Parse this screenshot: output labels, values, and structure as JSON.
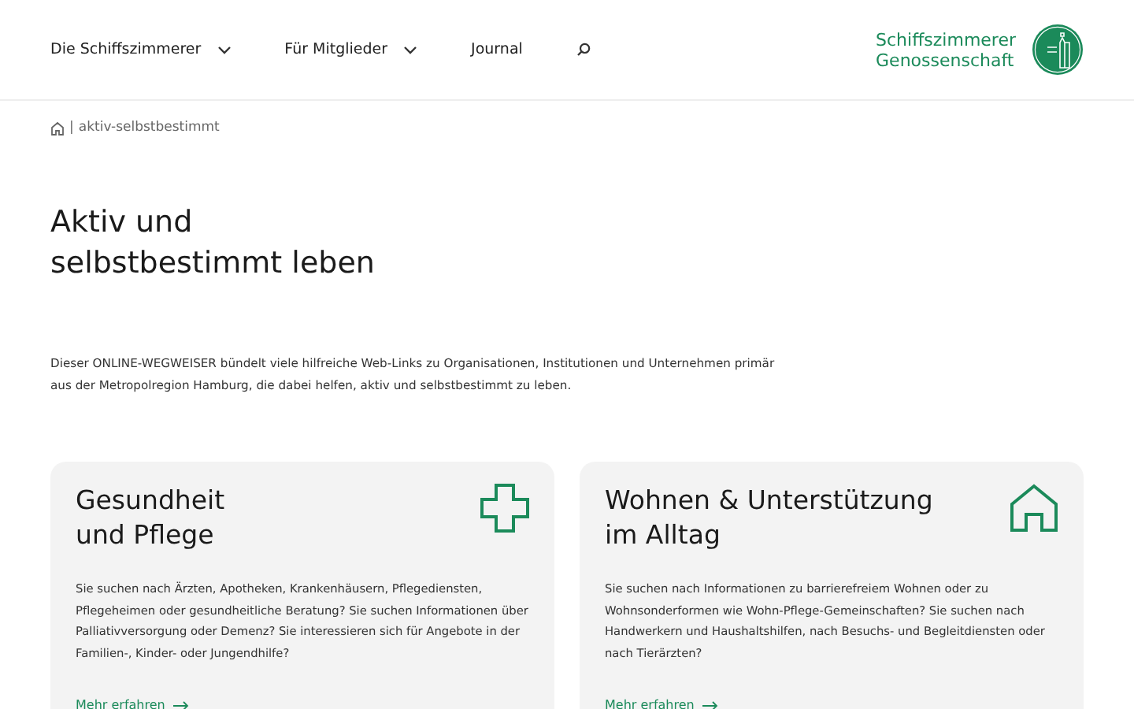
{
  "nav": {
    "items": [
      {
        "label": "Die Schiffszimmerer",
        "dropdown": true
      },
      {
        "label": "Für Mitglieder",
        "dropdown": true
      },
      {
        "label": "Journal",
        "dropdown": false
      }
    ],
    "logo": {
      "line1": "Schiffszimmerer",
      "line2": "Genossenschaft"
    }
  },
  "breadcrumb": {
    "separator": "|",
    "current": "aktiv-selbstbestimmt"
  },
  "title": {
    "line1": "Aktiv und",
    "line2": "selbstbestimmt leben"
  },
  "intro": "Dieser ONLINE-WEGWEISER bündelt viele hilfreiche Web-Links zu Organisationen, Institutionen und Unternehmen primär aus der Metropolregion Hamburg, die dabei helfen, aktiv und selbstbestimmt zu leben.",
  "cards": [
    {
      "kind": "cross",
      "title1": "Gesundheit",
      "title2": "und Pflege",
      "text": "Sie suchen nach Ärzten, Apotheken, Krankenhäusern, Pflegediensten, Pflegeheimen oder gesundheitliche Beratung? Sie suchen Informationen über Palliativversorgung oder Demenz? Sie interessieren sich für Angebote in der Familien-, Kinder- oder Jungendhilfe?",
      "link": "Mehr erfahren"
    },
    {
      "kind": "house",
      "title1": "Wohnen & Unterstützung",
      "title2": "im Alltag",
      "text": "Sie suchen nach Informationen zu barrierefreiem Wohnen oder zu Wohnsonderformen wie Wohn-Pflege-Gemeinschaften? Sie suchen nach Handwerkern und Haushaltshilfen, nach Besuchs- und Begleitdiensten oder nach Tierärzten?",
      "link": "Mehr erfahren"
    }
  ]
}
